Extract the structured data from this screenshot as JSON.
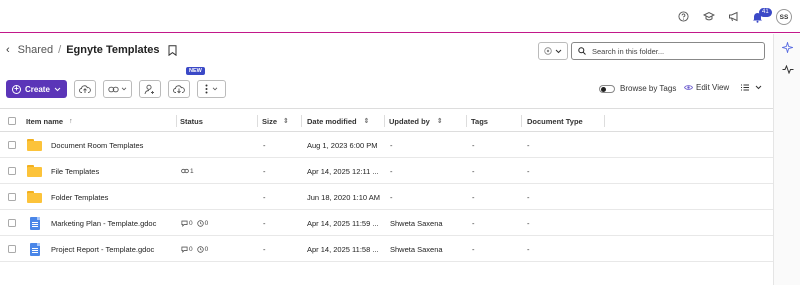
{
  "topbar": {
    "icons": [
      "help-icon",
      "graduation-cap-icon",
      "megaphone-icon",
      "bell-icon"
    ],
    "notification_count": "41",
    "avatar_initials": "SS"
  },
  "breadcrumb": {
    "parent": "Shared",
    "separator": "/",
    "current": "Egnyte Templates"
  },
  "search": {
    "placeholder": "Search in this folder..."
  },
  "toolbar": {
    "create_label": "Create",
    "new_badge": "NEW",
    "browse_by_tags_label": "Browse by Tags",
    "edit_view_label": "Edit View"
  },
  "table": {
    "columns": {
      "item_name": "Item name",
      "status": "Status",
      "size": "Size",
      "date_modified": "Date modified",
      "updated_by": "Updated by",
      "tags": "Tags",
      "document_type": "Document Type"
    },
    "rows": [
      {
        "icon": "folder-icon",
        "name": "Document Room Templates",
        "status": "",
        "size": "-",
        "date": "Aug 1, 2023 6:00 PM",
        "updated_by": "-",
        "tags": "-",
        "doc_type": "-"
      },
      {
        "icon": "folder-icon",
        "name": "File Templates",
        "status": "link",
        "link_count": "1",
        "size": "-",
        "date": "Apr 14, 2025 12:11 ...",
        "updated_by": "-",
        "tags": "-",
        "doc_type": "-"
      },
      {
        "icon": "folder-icon",
        "name": "Folder Templates",
        "status": "",
        "size": "-",
        "date": "Jun 18, 2020 1:10 AM",
        "updated_by": "-",
        "tags": "-",
        "doc_type": "-"
      },
      {
        "icon": "gdoc-icon",
        "name": "Marketing Plan - Template.gdoc",
        "status": "counts",
        "comments": "0",
        "tasks": "0",
        "size": "-",
        "date": "Apr 14, 2025 11:59 ...",
        "updated_by": "Shweta Saxena",
        "tags": "-",
        "doc_type": "-"
      },
      {
        "icon": "gdoc-icon",
        "name": "Project Report - Template.gdoc",
        "status": "counts",
        "comments": "0",
        "tasks": "0",
        "size": "-",
        "date": "Apr 14, 2025 11:58 ...",
        "updated_by": "Shweta Saxena",
        "tags": "-",
        "doc_type": "-"
      }
    ]
  },
  "colors": {
    "accent_bar": "#c2188a",
    "create_button": "#5b35b8",
    "badge": "#3b49c7",
    "folder": "#fcc33a",
    "gdoc": "#4a86e8"
  }
}
